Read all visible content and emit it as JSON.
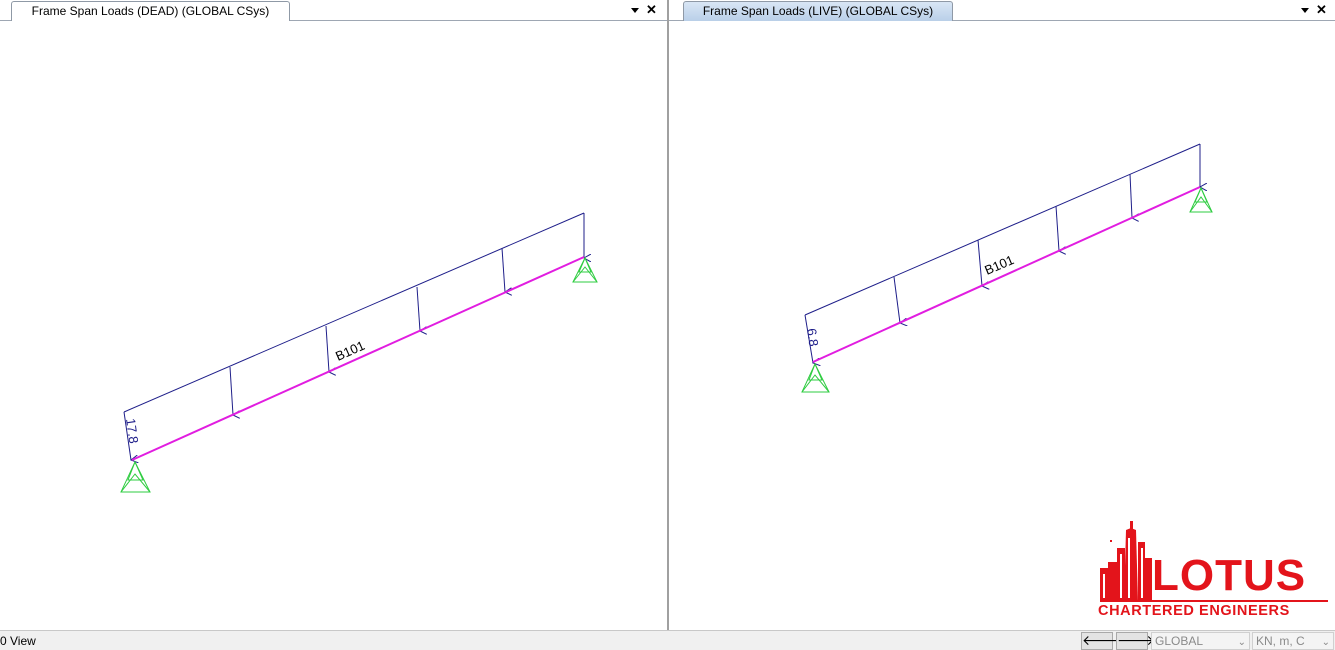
{
  "colors": {
    "load_arrows": "#1f1f8a",
    "beam": "#e11de0",
    "support": "#2ecc40",
    "tab_active": "#c4d7ee",
    "logo": "#e3141b"
  },
  "panes": [
    {
      "tab_title": "Frame Span Loads (DEAD) (GLOBAL CSys)",
      "active": false,
      "dropdown_icon": "chevron-down-icon",
      "close_icon": "close-icon",
      "frame_label": "B101",
      "load_value": "17.8"
    },
    {
      "tab_title": "Frame Span Loads (LIVE) (GLOBAL CSys)",
      "active": true,
      "dropdown_icon": "chevron-down-icon",
      "close_icon": "close-icon",
      "frame_label": "B101",
      "load_value": "6.8"
    }
  ],
  "statusbar": {
    "view_text": "0 View",
    "prev_icon": "arrow-left-icon",
    "next_icon": "arrow-right-icon",
    "coord_system": "GLOBAL",
    "units": "KN, m, C"
  },
  "logo": {
    "name": "LOTUS",
    "tagline": "CHARTERED ENGINEERS"
  }
}
